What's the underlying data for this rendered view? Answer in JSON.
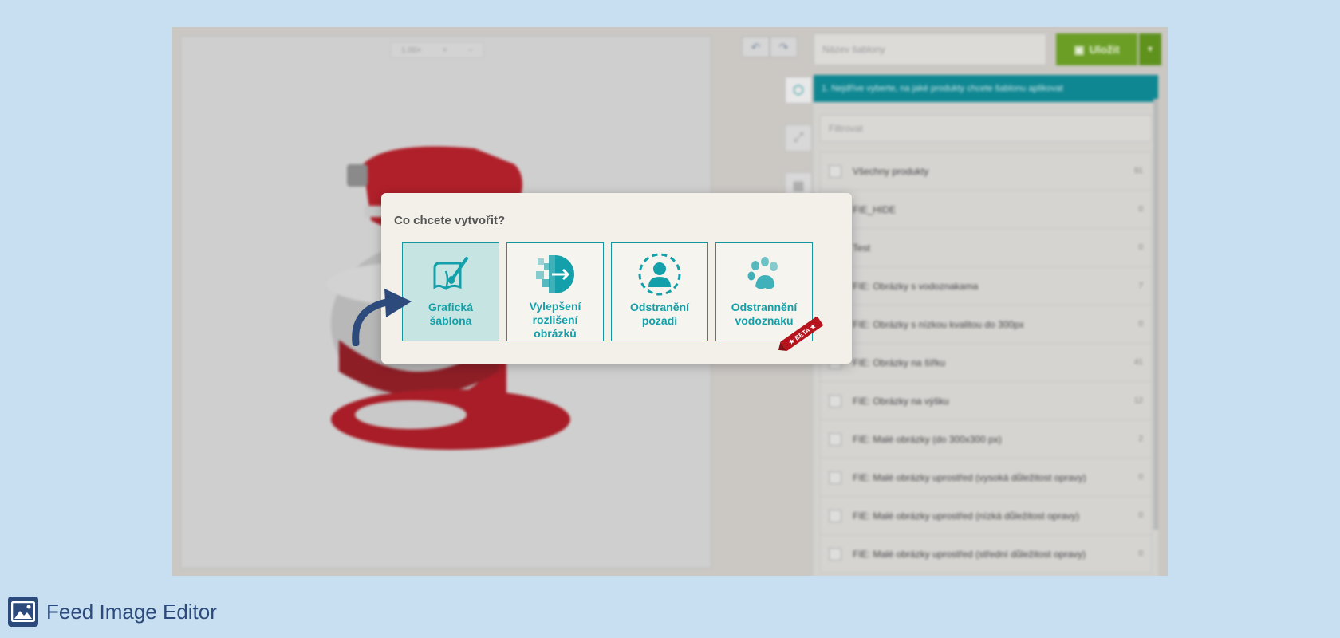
{
  "editor": {
    "zoom_label": "1.00×",
    "zoom_in": "+",
    "zoom_out": "−",
    "template_name_placeholder": "Název šablony",
    "save_label": "Uložit"
  },
  "panel": {
    "header": "1.   Nejdříve vyberte, na jaké produkty chcete šablonu aplikovat",
    "filter_placeholder": "Filtrovat",
    "items": [
      {
        "label": "Všechny produkty",
        "count": "91"
      },
      {
        "label": "FIE_HIDE",
        "count": "0"
      },
      {
        "label": "Test",
        "count": "0"
      },
      {
        "label": "FIE: Obrázky s vodoznakama",
        "count": "7"
      },
      {
        "label": "FIE: Obrázky s nízkou kvalitou do 300px",
        "count": "0"
      },
      {
        "label": "FIE: Obrázky na šířku",
        "count": "41"
      },
      {
        "label": "FIE: Obrázky na výšku",
        "count": "12"
      },
      {
        "label": "FIE: Malé obrázky (do 300x300 px)",
        "count": "2"
      },
      {
        "label": "FIE: Malé obrázky uprostřed (vysoká důležitost opravy)",
        "count": "0"
      },
      {
        "label": "FIE: Malé obrázky uprostřed (nízká důležitost opravy)",
        "count": "0"
      },
      {
        "label": "FIE: Malé obrázky uprostřed (střední důležitost opravy)",
        "count": "0"
      }
    ]
  },
  "modal": {
    "title": "Co chcete vytvořit?",
    "options": [
      {
        "label": "Grafická\nšablona",
        "icon": "paint-brush-template-icon"
      },
      {
        "label": "Vylepšení\nrozlišení\nobrázků",
        "icon": "pixel-upscale-icon"
      },
      {
        "label": "Odstranění\npozadí",
        "icon": "person-cutout-icon"
      },
      {
        "label": "Odstrannění\nvodoznaku",
        "icon": "paw-watermark-icon"
      }
    ],
    "beta_label": "★ BETA ★"
  },
  "brand": {
    "name": "Feed Image Editor"
  },
  "colors": {
    "accent": "#13a0aa",
    "save_green": "#6a9e25",
    "brand_blue": "#2d4a7c",
    "beta_red": "#b5141c"
  }
}
